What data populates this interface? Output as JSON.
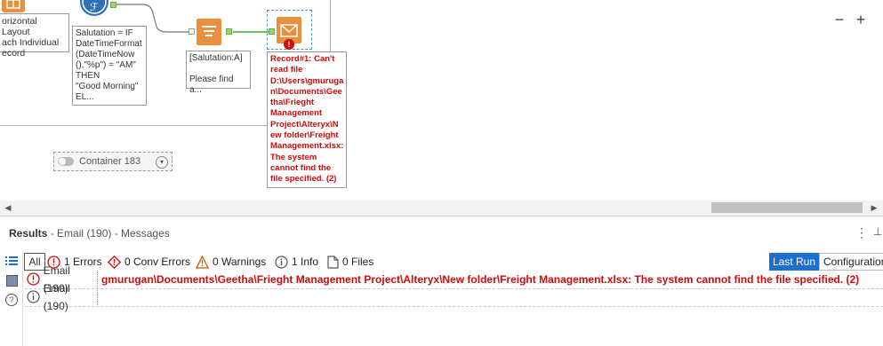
{
  "canvas": {
    "annotation_layout": "orizontal Layout\nach Individual\necord",
    "annotation_formula": "Salutation = IF\nDateTimeFormat\n(DateTimeNow\n(),\"%p\") = \"AM\"\nTHEN\n\"Good Morning\"\nEL...",
    "annotation_report": "[Salutation:A]\n\nPlease find a...",
    "annotation_error": "Record#1: Can't\nread file\nD:\\Users\\gmuruga\nn\\Documents\\Gee\ntha\\Frieght\nManagement\nProject\\Alteryx\\N\new folder\\Freight\nManagement.xlsx:\nThe system\ncannot find the\nfile specified. (2)",
    "container_label": "Container 183",
    "zoom_out": "−",
    "zoom_in": "+"
  },
  "results": {
    "title": "Results",
    "subtitle": "- Email (190) - Messages",
    "filters": {
      "all": "All",
      "errors": "1 Errors",
      "conv_errors": "0 Conv Errors",
      "warnings": "0 Warnings",
      "info": "1 Info",
      "files": "0 Files"
    },
    "last_run": "Last Run",
    "configuration": "Configuration",
    "rows": [
      {
        "tool": "Email (190)",
        "message": "gmurugan\\Documents\\Geetha\\Frieght Management Project\\Alteryx\\New folder\\Freight Management.xlsx: The system cannot find the file specified. (2)",
        "type": "error"
      },
      {
        "tool": "Email (190)",
        "message": "",
        "type": "info"
      }
    ]
  },
  "colors": {
    "error": "#d30a0a",
    "accent": "#1d6fcf",
    "anchor": "#9ed66d",
    "tool_orange": "#e8903c",
    "tool_blue": "#2f6fb5"
  }
}
